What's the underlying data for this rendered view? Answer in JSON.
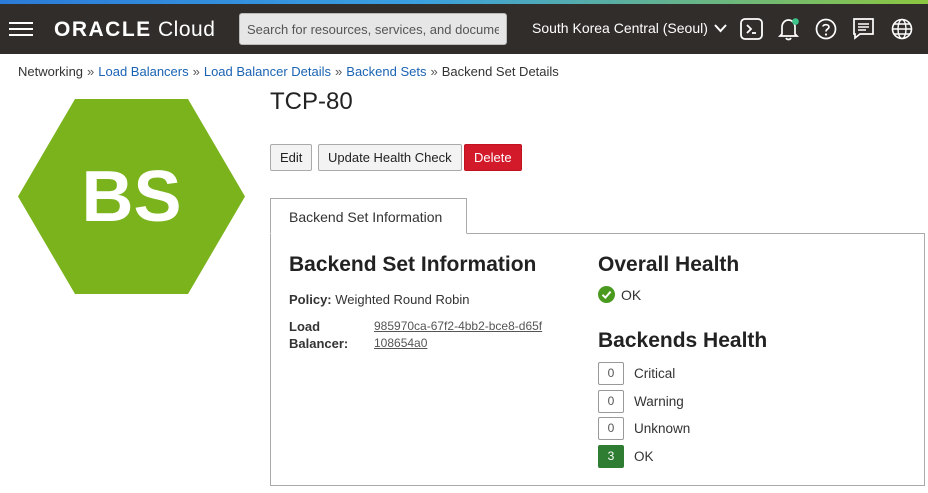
{
  "topbar": {
    "logo_brand": "ORACLE",
    "logo_product": "Cloud",
    "search_placeholder": "Search for resources, services, and documentation",
    "region": "South Korea Central (Seoul)"
  },
  "breadcrumb": [
    {
      "label": "Networking",
      "link": false
    },
    {
      "label": "Load Balancers",
      "link": true
    },
    {
      "label": "Load Balancer Details",
      "link": true
    },
    {
      "label": "Backend Sets",
      "link": true
    },
    {
      "label": "Backend Set Details",
      "link": false
    }
  ],
  "breadcrumb_separator": "»",
  "badge": {
    "text": "BS",
    "color": "#7ab31c"
  },
  "page": {
    "title": "TCP-80"
  },
  "actions": {
    "edit": "Edit",
    "update_health_check": "Update Health Check",
    "delete": "Delete"
  },
  "tab": {
    "label": "Backend Set Information"
  },
  "info": {
    "heading": "Backend Set Information",
    "policy_label": "Policy:",
    "policy_value": "Weighted Round Robin",
    "lb_label_line1": "Load",
    "lb_label_line2": "Balancer:",
    "lb_id": "985970ca-67f2-4bb2-bce8-d65f108654a0"
  },
  "overall_health": {
    "heading": "Overall Health",
    "status": "OK",
    "status_color": "#4a9a1f"
  },
  "backends_health": {
    "heading": "Backends Health",
    "rows": [
      {
        "count": "0",
        "label": "Critical"
      },
      {
        "count": "0",
        "label": "Warning"
      },
      {
        "count": "0",
        "label": "Unknown"
      },
      {
        "count": "3",
        "label": "OK"
      }
    ]
  }
}
